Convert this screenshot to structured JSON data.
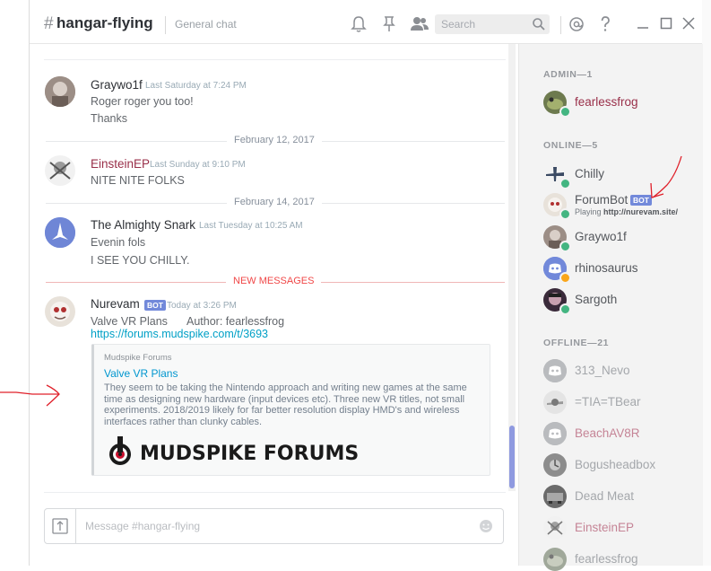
{
  "channel": {
    "hash": "#",
    "name": "hangar-flying",
    "topic": "General chat"
  },
  "toolbar": {
    "search_placeholder": "Search",
    "icons": [
      "bell-icon",
      "pin-icon",
      "members-icon",
      "search-icon",
      "mention-icon",
      "help-icon",
      "minimize-icon",
      "maximize-icon",
      "close-icon"
    ]
  },
  "messages": [
    {
      "author": "Graywo1f",
      "time": "Last Saturday at 7:24 PM",
      "lines": [
        "Roger roger you too!",
        "Thanks"
      ]
    },
    {
      "divider": "February 12, 2017"
    },
    {
      "author": "EinsteinEP",
      "time": "Last Sunday at 9:10 PM",
      "lines": [
        "NITE NITE FOLKS"
      ]
    },
    {
      "divider": "February 14, 2017"
    },
    {
      "author": "The Almighty Snark",
      "time": "Last Tuesday at 10:25 AM",
      "lines": [
        "Evenin fols",
        "I SEE YOU CHILLY."
      ]
    },
    {
      "divider_new": "NEW MESSAGES"
    },
    {
      "author": "Nurevam",
      "bot_tag": "BOT",
      "time": "Today at 3:26 PM",
      "line1_left": "Valve VR Plans",
      "line1_right": "Author: fearlessfrog",
      "link": "https://forums.mudspike.com/t/3693",
      "embed": {
        "provider": "Mudspike Forums",
        "title": "Valve VR Plans",
        "description": "They seem to be taking the Nintendo approach and writing new games at the same time as designing new hardware (input devices etc). Three new VR titles, not small experiments. 2018/2019 likely for far better resolution display HMD's and wireless interfaces rather than clunky cables.",
        "logo_text": "MUDSPIKE FORUMS"
      }
    }
  ],
  "input": {
    "placeholder": "Message #hangar-flying"
  },
  "members": {
    "admin_header": "ADMIN—1",
    "admin": [
      {
        "name": "fearlessfrog",
        "status": "online"
      }
    ],
    "online_header": "ONLINE—5",
    "online": [
      {
        "name": "Chilly",
        "status": "online"
      },
      {
        "name": "ForumBot",
        "bot_tag": "BOT",
        "playing_prefix": "Playing",
        "playing": "http://nurevam.site/",
        "status": "online"
      },
      {
        "name": "Graywo1f",
        "status": "online"
      },
      {
        "name": "rhinosaurus",
        "status": "idle"
      },
      {
        "name": "Sargoth",
        "status": "online"
      }
    ],
    "offline_header": "OFFLINE—21",
    "offline": [
      {
        "name": "313_Nevo"
      },
      {
        "name": "=TIA=TBear"
      },
      {
        "name": "BeachAV8R"
      },
      {
        "name": "Bogusheadbox"
      },
      {
        "name": "Dead Meat"
      },
      {
        "name": "EinsteinEP"
      },
      {
        "name": "fearlessfrog"
      }
    ]
  },
  "colors": {
    "accent": "#7289da",
    "new_messages": "#f04747",
    "online": "#43b581",
    "idle": "#faa61a",
    "link": "#00a0c6",
    "annotation": "#e0202a"
  }
}
